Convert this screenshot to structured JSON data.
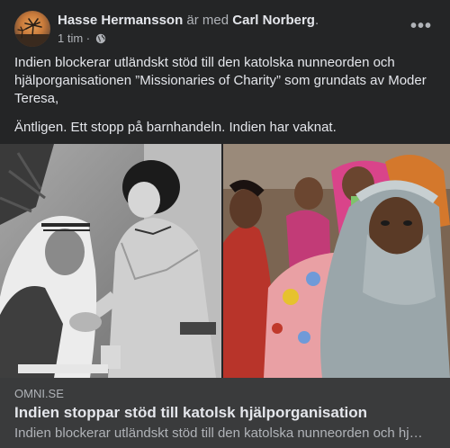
{
  "post": {
    "author": "Hasse Hermansson",
    "with_text": "är med",
    "tagged": "Carl Norberg",
    "period": ".",
    "time": "1 tim",
    "separator": "·",
    "privacy_icon": "globe-icon",
    "more_icon": "more-options-icon",
    "more_label": "•••",
    "paragraphs": [
      "Indien blockerar utländskt stöd till den katolska nunneorden och hjälporganisationen ”Missionaries of Charity” som grundats av Moder Teresa,",
      "Äntligen. Ett stopp på barnhandeln. Indien har vaknat."
    ]
  },
  "link_preview": {
    "domain": "OMNI.SE",
    "title": "Indien stoppar stöd till katolsk hjälporganisation",
    "description": "Indien blockerar utländskt stöd till den katolska nunneorden och hjälporganisationen"
  },
  "colors": {
    "background": "#242526",
    "card": "#3a3b3c",
    "primary_text": "#e4e6eb",
    "secondary_text": "#b0b3b8"
  }
}
